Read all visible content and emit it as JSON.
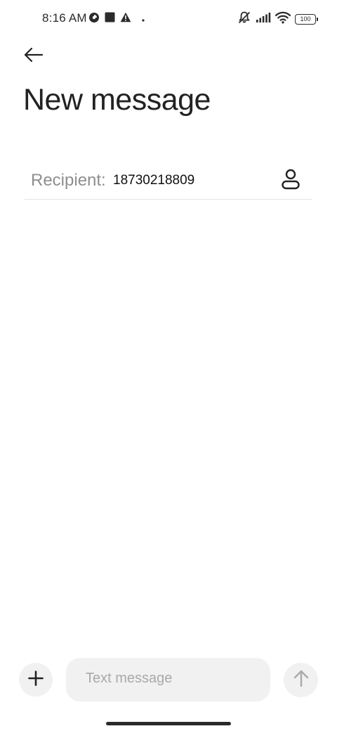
{
  "status_bar": {
    "time": "8:16 AM",
    "left_icons": [
      "data-saver-icon",
      "stop-square-icon",
      "warning-icon",
      "dot-icon"
    ],
    "right_icons": [
      "vibrate-off-icon",
      "signal-icon",
      "wifi-icon",
      "battery-icon"
    ],
    "battery_level": "100"
  },
  "header": {
    "back_icon": "arrow-left-icon",
    "title": "New message"
  },
  "recipient": {
    "label": "Recipient:",
    "value": "18730218809",
    "contact_icon": "person-icon"
  },
  "composer": {
    "attach_icon": "plus-icon",
    "placeholder": "Text message",
    "send_icon": "arrow-up-icon"
  },
  "colors": {
    "background": "#ffffff",
    "text_primary": "#222222",
    "text_secondary": "#8e8e8e",
    "field_background": "#f1f1f1",
    "divider": "#e3e3e3"
  }
}
